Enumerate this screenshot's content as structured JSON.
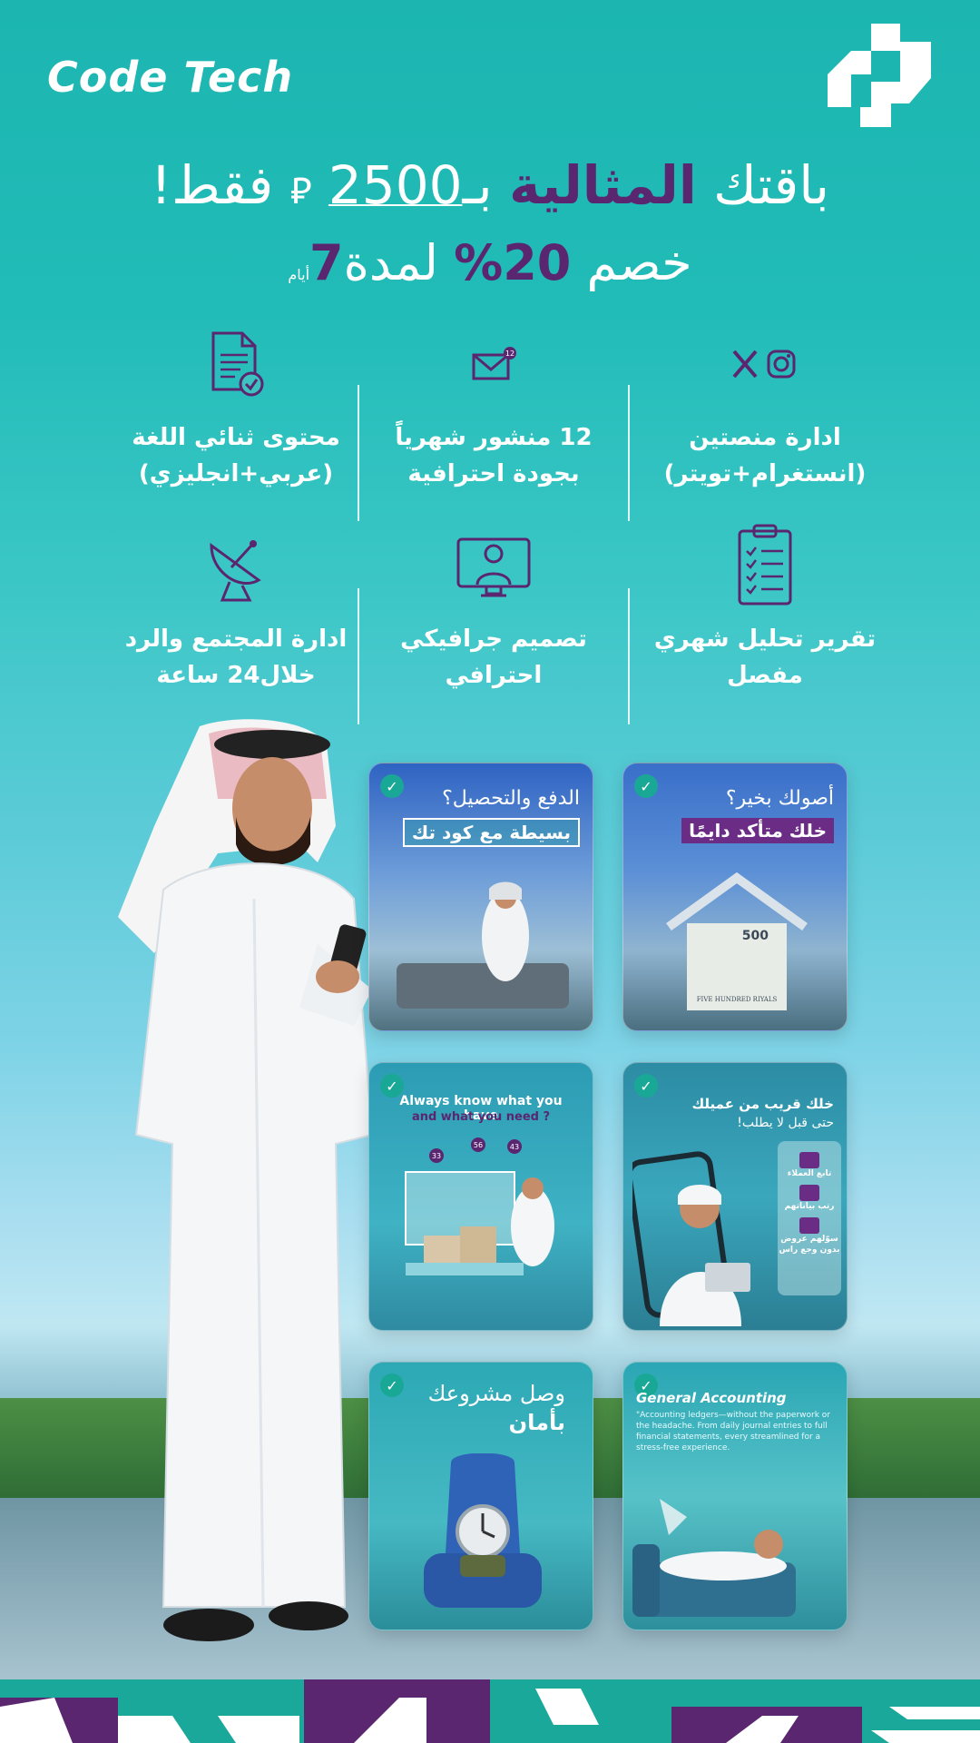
{
  "brand": {
    "name": "Code Tech"
  },
  "headline": {
    "prefix": "باقتك",
    "highlight": "المثالية",
    "bi": "بـ",
    "price": "2500",
    "currency_icon": "saudi-riyal-symbol",
    "suffix": "فقط!"
  },
  "offer": {
    "prefix": "خصم",
    "percent": "20%",
    "mid": "لمدة",
    "days_num": "7",
    "days_word": "أيام"
  },
  "features": [
    {
      "icon": "social-x-instagram-icon",
      "line1": "ادارة منصتين",
      "line2": "(انستغرام+تويتر)"
    },
    {
      "icon": "mail-badge-icon",
      "badge": "12",
      "line1": "12 منشور شهرياً",
      "line2": "بجودة احترافية"
    },
    {
      "icon": "document-check-icon",
      "line1": "محتوى ثنائي اللغة",
      "line2": "(عربي+انجليزي)"
    },
    {
      "icon": "clipboard-checklist-icon",
      "line1": "تقرير تحليل شهري",
      "line2": "مفصل"
    },
    {
      "icon": "designer-monitor-icon",
      "line1": "تصميم جرافيكي",
      "line2": "احترافي"
    },
    {
      "icon": "satellite-dish-icon",
      "line1": "ادارة المجتمع والرد",
      "line2": "خلال24 ساعة"
    }
  ],
  "cards": {
    "c1": {
      "title": "أصولك بخير؟",
      "highlight": "خلك متأكد دايمًا",
      "note": "500",
      "note_text": "FIVE HUNDRED RIYALS"
    },
    "c2": {
      "title": "الدفع والتحصيل؟",
      "highlight": "بسيطة مع كود تك"
    },
    "c3": {
      "title": "خلك قريب من عميلك",
      "sub": "حتى قبل لا يطلب!",
      "panel": [
        "تابع العملاء",
        "رتب بياناتهم",
        "سوّلهم عروض بدون وجع راس"
      ]
    },
    "c4": {
      "title": "Always know what you have",
      "sub": "and what you need ?",
      "badges": [
        "33",
        "56",
        "43"
      ]
    },
    "c5": {
      "title": "General Accounting",
      "body": "\"Accounting ledgers—without the paperwork or the headache. From daily journal entries to full financial statements, every streamlined for a stress-free experience."
    },
    "c6": {
      "title": "وصل مشروعك",
      "sub": "بأمان"
    }
  },
  "colors": {
    "brand_teal": "#1cb5b0",
    "brand_purple": "#5b2670",
    "check_green": "#1aa896"
  }
}
